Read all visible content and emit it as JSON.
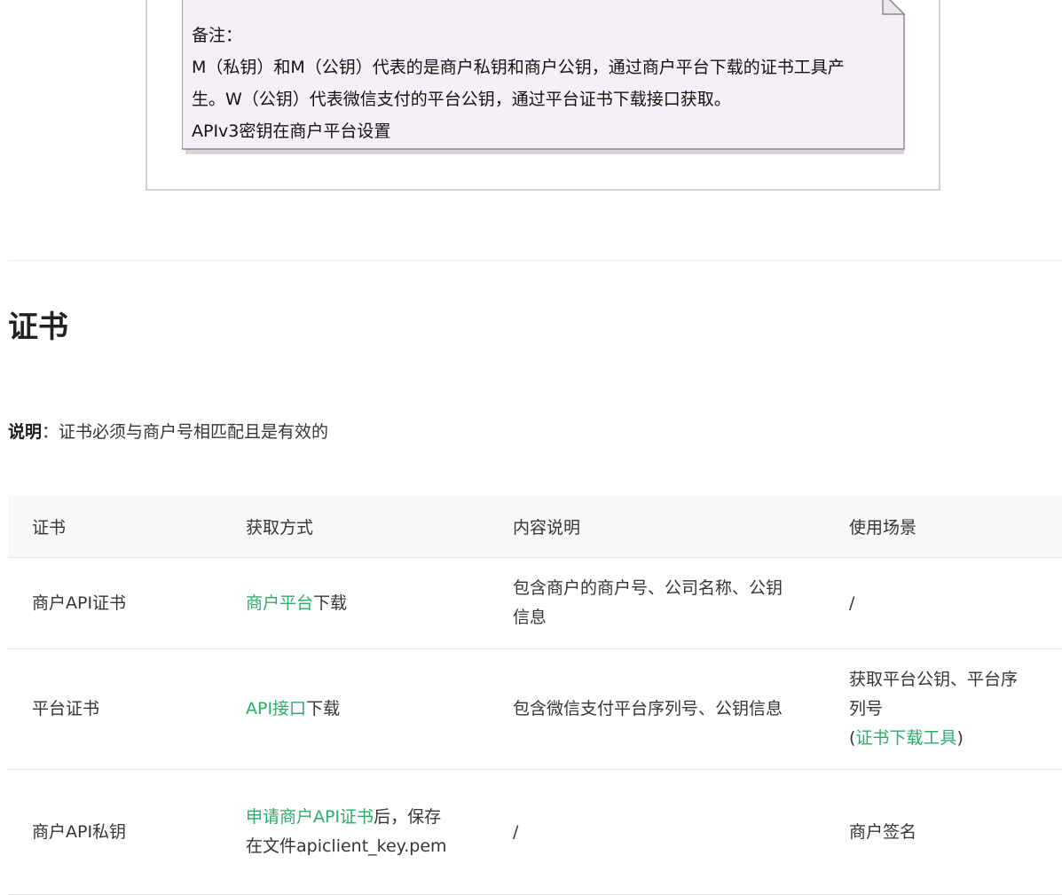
{
  "note": {
    "title": "备注：",
    "line1": "M（私钥）和M（公钥）代表的是商户私钥和商户公钥，通过商户平台下载的证书工具产",
    "line2": "生。W（公钥）代表微信支付的平台公钥，通过平台证书下载接口获取。",
    "line3": "APIv3密钥在商户平台设置"
  },
  "section": {
    "heading": "证书",
    "explain_label": "说明",
    "explain_text": "：证书必须与商户号相匹配且是有效的"
  },
  "table": {
    "headers": [
      "证书",
      "获取方式",
      "内容说明",
      "使用场景"
    ],
    "rows": [
      {
        "cert": "商户API证书",
        "method_link": "商户平台",
        "method_text": "下载",
        "content": "包含商户的商户号、公司名称、公钥信息",
        "usage": "/"
      },
      {
        "cert": "平台证书",
        "method_link": "API接口",
        "method_text": "下载",
        "content": "包含微信支付平台序列号、公钥信息",
        "usage": "获取平台公钥、平台序列号",
        "usage_open": "(",
        "usage_link": "证书下载工具",
        "usage_close": ")"
      },
      {
        "cert": "商户API私钥",
        "method_link": "申请商户API证书",
        "method_text": "后，保存在文件apiclient_key.pem",
        "content": "/",
        "usage": "商户签名"
      }
    ]
  },
  "colors": {
    "link": "#2aae67",
    "note_fill": "#f6eff6",
    "note_border": "#999999"
  }
}
